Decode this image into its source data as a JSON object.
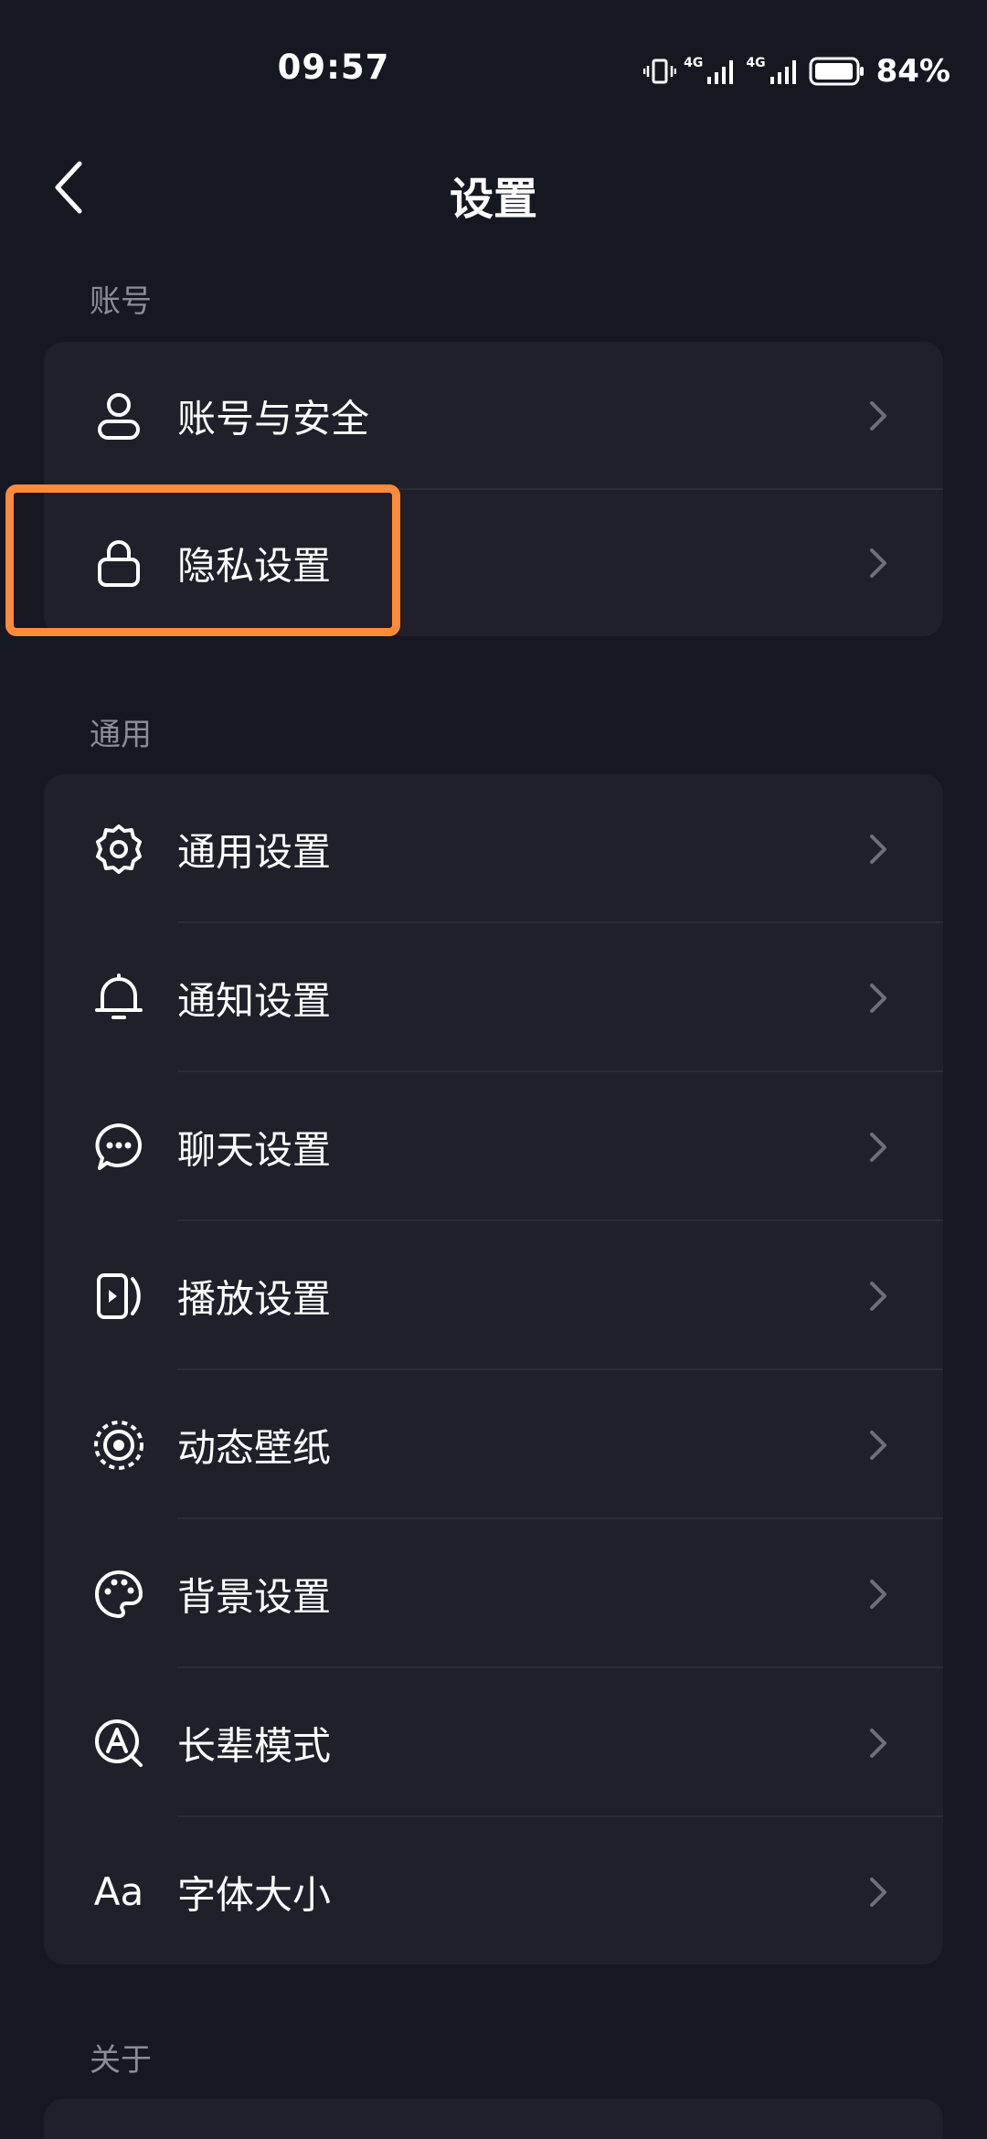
{
  "status_bar": {
    "time": "09:57",
    "network_1": "4G",
    "network_2": "4G",
    "battery_percent": "84%"
  },
  "header": {
    "title": "设置"
  },
  "sections": {
    "account": {
      "label": "账号",
      "items": [
        {
          "label": "账号与安全",
          "icon": "user-icon"
        },
        {
          "label": "隐私设置",
          "icon": "lock-icon"
        }
      ]
    },
    "general": {
      "label": "通用",
      "items": [
        {
          "label": "通用设置",
          "icon": "gear-icon"
        },
        {
          "label": "通知设置",
          "icon": "bell-icon"
        },
        {
          "label": "聊天设置",
          "icon": "chat-bubble-icon"
        },
        {
          "label": "播放设置",
          "icon": "play-icon"
        },
        {
          "label": "动态壁纸",
          "icon": "live-wallpaper-icon"
        },
        {
          "label": "背景设置",
          "icon": "palette-icon"
        },
        {
          "label": "长辈模式",
          "icon": "elder-mode-icon"
        },
        {
          "label": "字体大小",
          "icon": "font-size-icon",
          "icon_text": "Aa"
        }
      ]
    },
    "about": {
      "label": "关于"
    }
  },
  "colors": {
    "background": "#161821",
    "card": "#1f2029",
    "highlight": "#ff8a3a",
    "section_label": "#8b8d96",
    "chevron": "#6e7079"
  }
}
